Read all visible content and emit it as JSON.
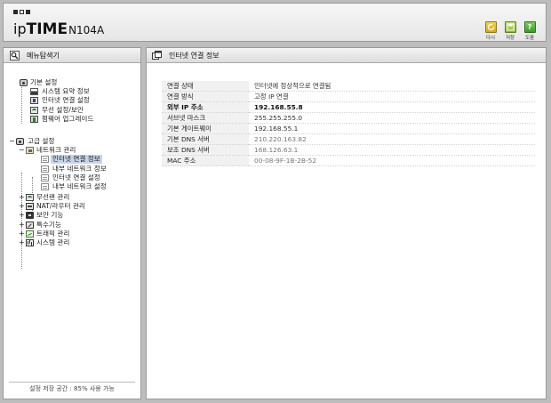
{
  "header": {
    "brand_prefix": "ip",
    "brand_main": "TIME",
    "model": "N104A",
    "buttons": [
      {
        "label": "다시",
        "icon": "refresh-icon",
        "glyph": ""
      },
      {
        "label": "저장",
        "icon": "save-icon",
        "glyph": ""
      },
      {
        "label": "도움",
        "icon": "help-icon",
        "glyph": "?"
      }
    ]
  },
  "sidebar": {
    "title": "메뉴탐색기",
    "storage_text": "설정 저장 공간 : 85% 사용 가능",
    "basic": {
      "label": "기본 설정",
      "items": [
        {
          "label": "시스템 요약 정보",
          "icon": "system-summary-icon"
        },
        {
          "label": "인터넷 연결 설정",
          "icon": "internet-settings-icon"
        },
        {
          "label": "무선 설정/보안",
          "icon": "wireless-security-icon"
        },
        {
          "label": "펌웨어 업그레이드",
          "icon": "firmware-upgrade-icon"
        }
      ]
    },
    "advanced": {
      "label": "고급 설정",
      "network": {
        "label": "네트워크 관리",
        "items": [
          {
            "label": "인터넷 연결 정보",
            "selected": true
          },
          {
            "label": "내부 네트워크 정보",
            "selected": false
          },
          {
            "label": "인터넷 연결 설정",
            "selected": false
          },
          {
            "label": "내부 네트워크 설정",
            "selected": false
          }
        ]
      },
      "groups": [
        {
          "label": "무선랜 관리",
          "icon": "wireless-lan-icon"
        },
        {
          "label": "NAT/라우터 관리",
          "icon": "nat-router-icon"
        },
        {
          "label": "보안 기능",
          "icon": "lock-icon"
        },
        {
          "label": "특수기능",
          "icon": "special-function-icon"
        },
        {
          "label": "트래픽 관리",
          "icon": "traffic-icon"
        },
        {
          "label": "시스템 관리",
          "icon": "system-management-icon"
        }
      ]
    }
  },
  "main": {
    "title": "인터넷 연결 정보",
    "rows": [
      {
        "key": "연결 상태",
        "value": "인터넷에 정상적으로 연결됨",
        "bold": false,
        "faint": false
      },
      {
        "key": "연결 방식",
        "value": "고정 IP 연결",
        "bold": false,
        "faint": false
      },
      {
        "key": "외부 IP 주소",
        "value": "192.168.55.8",
        "bold": true,
        "faint": false
      },
      {
        "key": "서브넷 마스크",
        "value": "255.255.255.0",
        "bold": false,
        "faint": false
      },
      {
        "key": "기본 게이트웨이",
        "value": "192.168.55.1",
        "bold": false,
        "faint": false
      },
      {
        "key": "기본 DNS 서버",
        "value": "210.220.163.82",
        "bold": false,
        "faint": true
      },
      {
        "key": "보조 DNS 서버",
        "value": "168.126.63.1",
        "bold": false,
        "faint": true
      },
      {
        "key": "MAC 주소",
        "value": "00-08-9F-1B-2B-52",
        "bold": false,
        "faint": true
      }
    ]
  }
}
